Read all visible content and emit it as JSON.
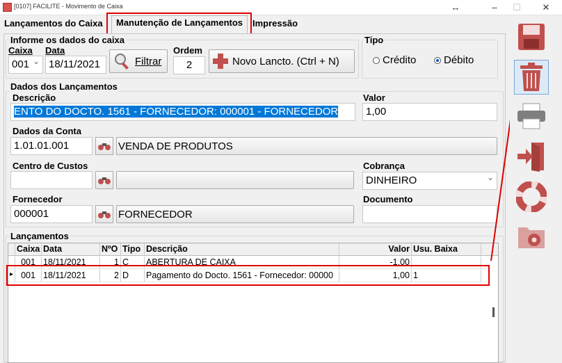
{
  "window": {
    "title": "[0107] FACILITE - Movimento de Caixa",
    "restore": "↔",
    "minimize": "–",
    "maximize": "☐",
    "close": "✕"
  },
  "tabs": [
    "Lançamentos do Caixa",
    "Manutenção de Lançamentos",
    "Impressão"
  ],
  "caixa_group": {
    "title": "Informe os dados do caixa",
    "caixa_label": "Caixa",
    "caixa_value": "001",
    "data_label": "Data",
    "data_value": "18/11/2021",
    "filtrar_label": "Filtrar",
    "ordem_label": "Ordem",
    "ordem_value": "2",
    "novo_label": "Novo Lancto. (Ctrl + N)"
  },
  "tipo": {
    "title": "Tipo",
    "credito": "Crédito",
    "debito": "Débito",
    "selected": "Débito"
  },
  "lanc_group": {
    "title": "Dados dos Lançamentos",
    "descricao_label": "Descrição",
    "descricao_value": "ENTO DO DOCTO. 1561 - FORNECEDOR: 000001 - FORNECEDOR",
    "valor_label": "Valor",
    "valor_value": "1,00",
    "conta_label": "Dados da Conta",
    "conta_code": "1.01.01.001",
    "conta_name": "VENDA DE PRODUTOS",
    "centro_label": "Centro de Custos",
    "centro_code": "",
    "centro_name": "",
    "cobranca_label": "Cobrança",
    "cobranca_value": "DINHEIRO",
    "fornecedor_label": "Fornecedor",
    "fornecedor_code": "000001",
    "fornecedor_name": "FORNECEDOR",
    "documento_label": "Documento",
    "documento_value": ""
  },
  "grid": {
    "title": "Lançamentos",
    "columns": [
      "Caixa",
      "Data",
      "NºO",
      "Tipo",
      "Descrição",
      "Valor",
      "Usu. Baixa"
    ],
    "rows": [
      {
        "indicator": "",
        "caixa": "001",
        "data": "18/11/2021",
        "no": "1",
        "tipo": "C",
        "descricao": "ABERTURA DE CAIXA",
        "valor": "-1,00",
        "usu": ""
      },
      {
        "indicator": "▸",
        "caixa": "001",
        "data": "18/11/2021",
        "no": "2",
        "tipo": "D",
        "descricao": "Pagamento do Docto. 1561 - Fornecedor: 00000",
        "valor": "1,00",
        "usu": "1"
      }
    ]
  },
  "toolbar": [
    "save-icon",
    "trash-icon",
    "print-icon",
    "exit-icon",
    "help-icon",
    "settings-icon"
  ],
  "colors": {
    "accent": "#0078d7",
    "highlight_red": "#e00000",
    "icon_red": "#c0504d"
  }
}
